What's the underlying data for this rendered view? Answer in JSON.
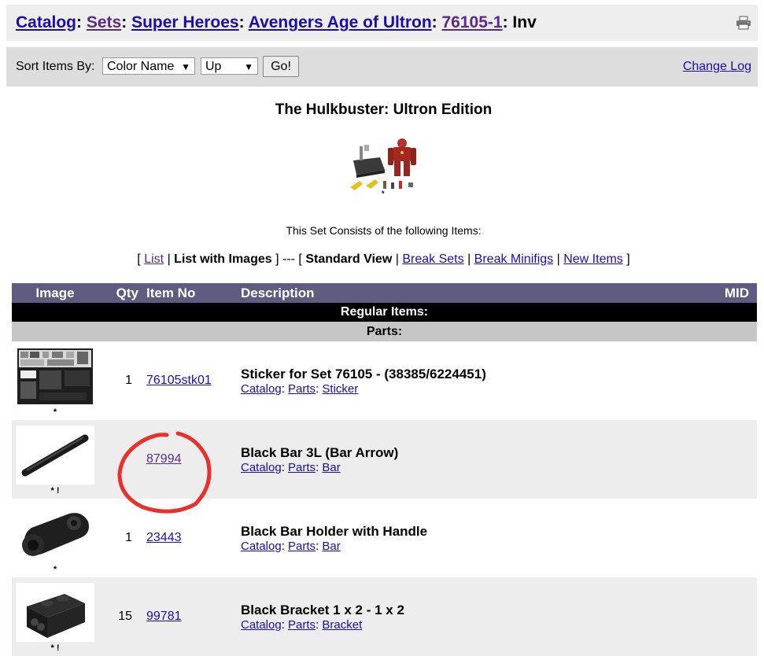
{
  "breadcrumb": {
    "catalog": "Catalog",
    "sets": "Sets",
    "theme": "Super Heroes",
    "subtheme": "Avengers Age of Ultron",
    "set_no": "76105-1",
    "page": "Inv",
    "sep": ":"
  },
  "sort": {
    "label": "Sort Items By:",
    "field_value": "Color Name",
    "direction_value": "Up",
    "go_label": "Go!",
    "change_log": "Change Log"
  },
  "set": {
    "title": "The Hulkbuster: Ultron Edition",
    "image_mark": "*",
    "consists_text": "This Set Consists of the following Items:"
  },
  "views": {
    "open": "[",
    "list": "List",
    "sep1": "|",
    "list_with_images": "List with Images",
    "close_dash": "] --- [",
    "standard_view": "Standard View",
    "sep2": "|",
    "break_sets": "Break Sets",
    "sep3": "|",
    "break_minifigs": "Break Minifigs",
    "sep4": "|",
    "new_items": "New Items",
    "close": "]"
  },
  "table": {
    "headers": {
      "image": "Image",
      "qty": "Qty",
      "item_no": "Item No",
      "description": "Description",
      "mid": "MID"
    },
    "section": "Regular Items:",
    "subsection": "Parts:",
    "rows": [
      {
        "mark": "*",
        "qty": "1",
        "item_no": "76105stk01",
        "title": "Sticker for Set 76105 - (38385/6224451)",
        "link1": "Catalog",
        "link2": "Parts",
        "link3": "Sticker",
        "sep": ":"
      },
      {
        "mark": "* !",
        "qty": "",
        "item_no": "87994",
        "title": "Black Bar 3L (Bar Arrow)",
        "link1": "Catalog",
        "link2": "Parts",
        "link3": "Bar",
        "sep": ":"
      },
      {
        "mark": "*",
        "qty": "1",
        "item_no": "23443",
        "title": "Black Bar Holder with Handle",
        "link1": "Catalog",
        "link2": "Parts",
        "link3": "Bar",
        "sep": ":"
      },
      {
        "mark": "* !",
        "qty": "15",
        "item_no": "99781",
        "title": "Black Bracket 1 x 2 - 1 x 2",
        "link1": "Catalog",
        "link2": "Parts",
        "link3": "Bracket",
        "sep": ":"
      }
    ]
  },
  "annotation": {
    "color": "#e8312f"
  },
  "colors": {
    "header_bg": "#5e5a80",
    "link": "#1a0dab",
    "visited": "#5a2a8a"
  }
}
